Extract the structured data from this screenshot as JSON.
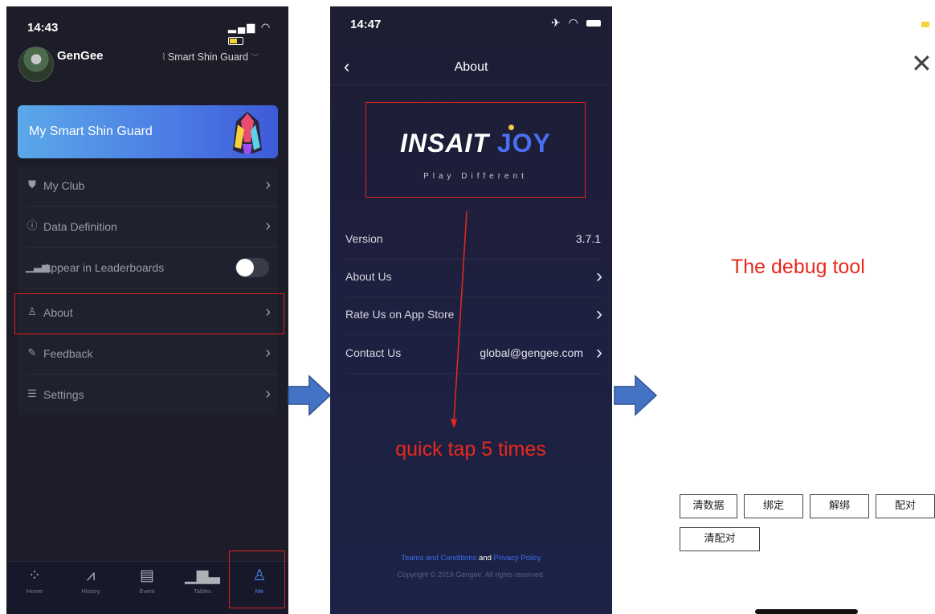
{
  "colors": {
    "accent_blue": "#4b8bf4",
    "annotation_red": "#e8281c",
    "dark_bg": "#1c1d29"
  },
  "screen1": {
    "status_time": "14:43",
    "user_name": "GenGee",
    "device_name": "Smart Shin Guard",
    "card_title": "My Smart Shin Guard",
    "menu": [
      {
        "icon": "shield-icon",
        "label": "My Club"
      },
      {
        "icon": "info-icon",
        "label": "Data Definition"
      },
      {
        "icon": "bar-chart-icon",
        "label": "Appear in Leaderboards",
        "toggle_on": true
      },
      {
        "icon": "user-icon",
        "label": "About"
      },
      {
        "icon": "edit-icon",
        "label": "Feedback"
      },
      {
        "icon": "sliders-icon",
        "label": "Settings"
      }
    ],
    "tabs": [
      {
        "icon": "grid-icon",
        "label": "Home"
      },
      {
        "icon": "chart-line-icon",
        "label": "History"
      },
      {
        "icon": "list-icon",
        "label": "Event"
      },
      {
        "icon": "bar-chart-icon",
        "label": "Tables"
      },
      {
        "icon": "person-icon",
        "label": "Me",
        "active": true
      }
    ]
  },
  "screen2": {
    "status_time": "14:47",
    "title": "About",
    "logo_main": "INSAIT",
    "logo_accent": "JOY",
    "tagline": "Play Different",
    "rows": [
      {
        "label": "Version",
        "value": "3.7.1"
      },
      {
        "label": "About Us"
      },
      {
        "label": "Rate Us on App Store"
      },
      {
        "label": "Contact Us",
        "value": "global@gengee.com"
      }
    ],
    "annotation": "quick tap 5 times",
    "footer_link1": "Teams and Conditions",
    "footer_and": "and",
    "footer_link2": "Privacy Policy",
    "copyright": "Copyright © 2019 Gengee. All rights reserved."
  },
  "screen3": {
    "caption": "The debug tool",
    "buttons": [
      "清数据",
      "绑定",
      "解绑",
      "配对",
      "清配对"
    ]
  }
}
